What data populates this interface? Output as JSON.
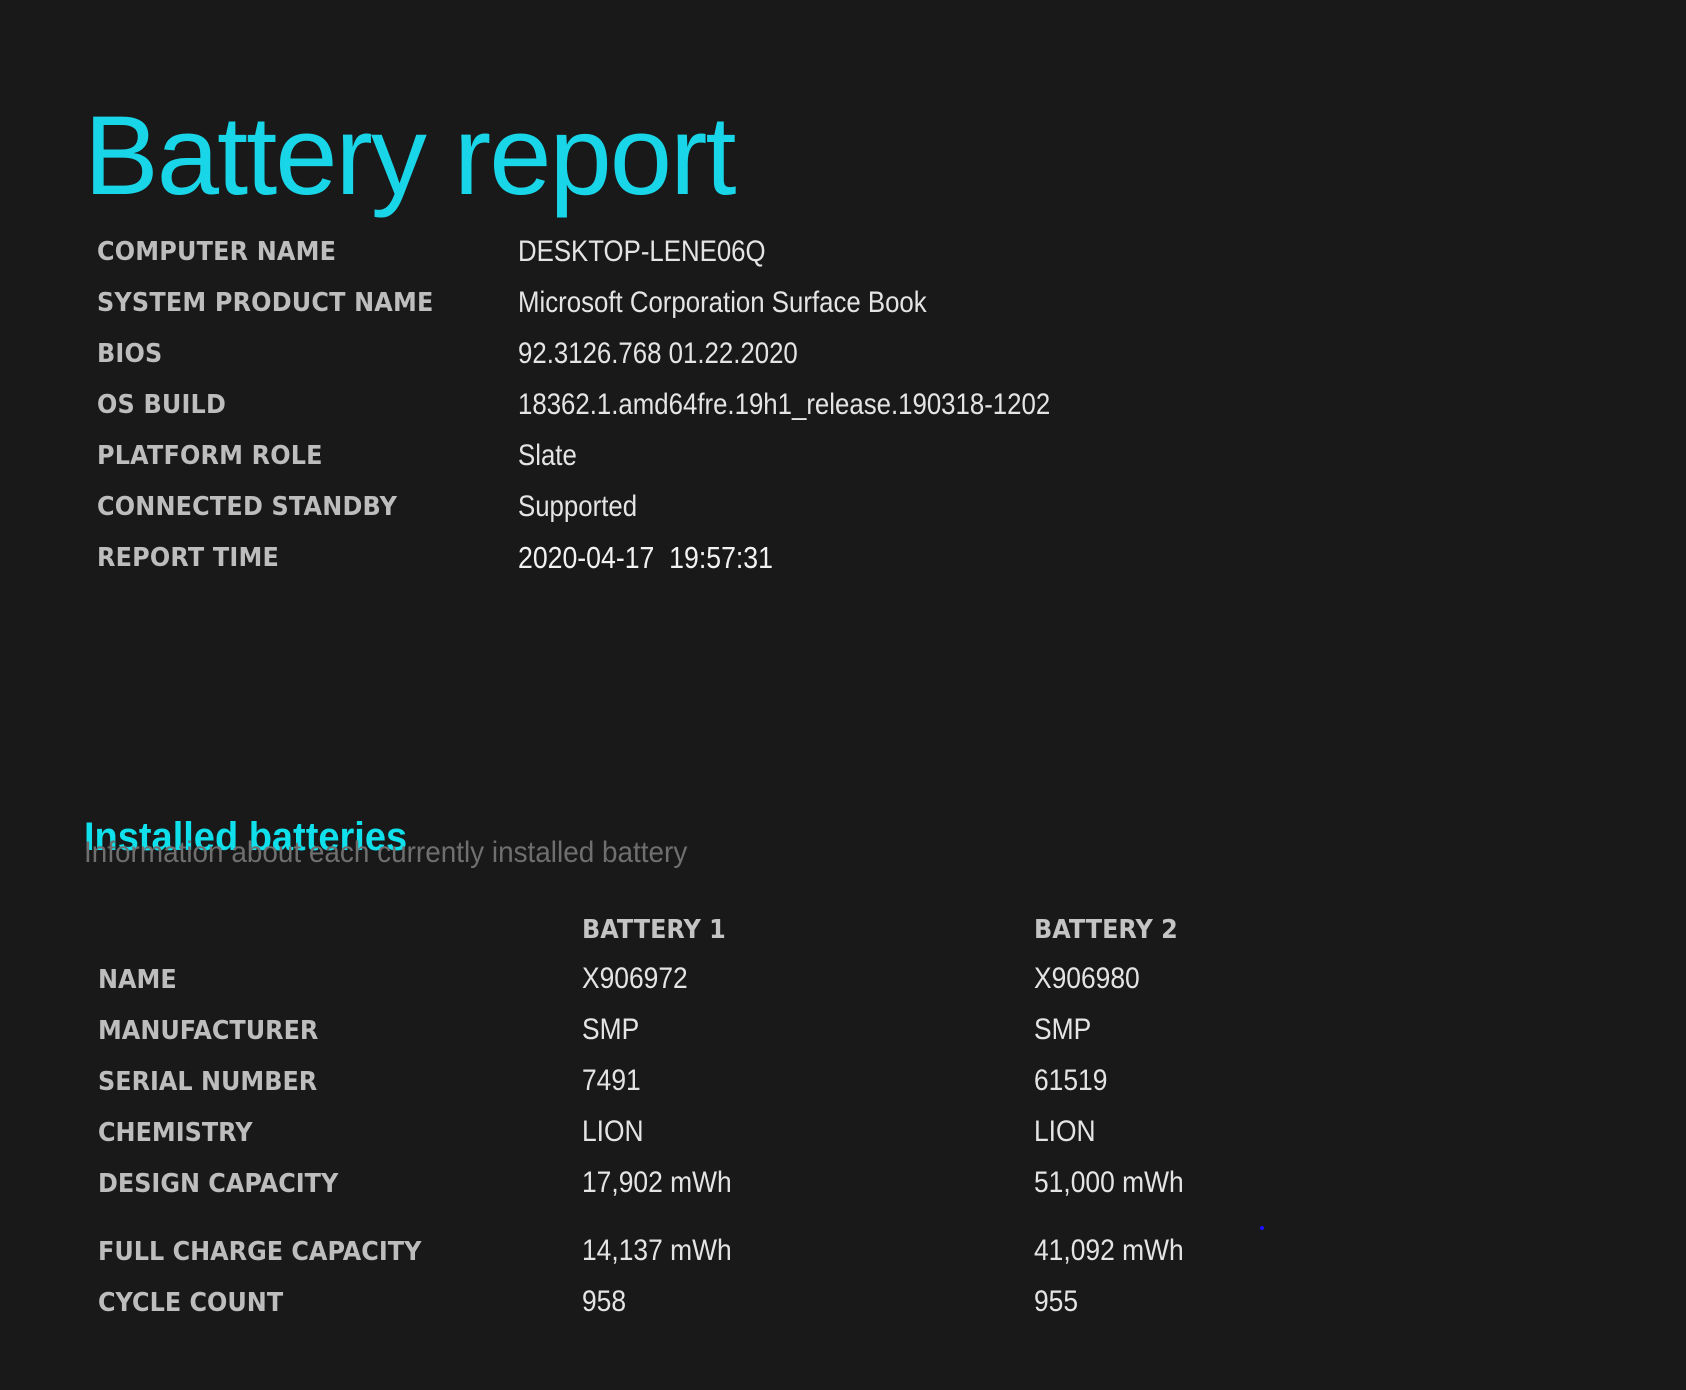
{
  "theme": {
    "accent": "#18D6E8",
    "accent_section": "#0FE0EC",
    "background": "#191919"
  },
  "header": {
    "title": "Battery report"
  },
  "system_info": [
    {
      "label": "COMPUTER NAME",
      "value": "DESKTOP-LENE06Q"
    },
    {
      "label": "SYSTEM PRODUCT NAME",
      "value": "Microsoft Corporation Surface Book"
    },
    {
      "label": "BIOS",
      "value": "92.3126.768 01.22.2020"
    },
    {
      "label": "OS BUILD",
      "value": "18362.1.amd64fre.19h1_release.190318-1202"
    },
    {
      "label": "PLATFORM ROLE",
      "value": "Slate"
    },
    {
      "label": "CONNECTED STANDBY",
      "value": "Supported"
    },
    {
      "label": "REPORT TIME",
      "value": "2020-04-17  19:57:31"
    }
  ],
  "installed_batteries": {
    "title": "Installed batteries",
    "subtitle": "Information about each currently installed battery",
    "columns": [
      "BATTERY 1",
      "BATTERY 2"
    ],
    "rows": [
      {
        "label": "NAME",
        "values": [
          "X906972",
          "X906980"
        ]
      },
      {
        "label": "MANUFACTURER",
        "values": [
          "SMP",
          "SMP"
        ]
      },
      {
        "label": "SERIAL NUMBER",
        "values": [
          "7491",
          "61519"
        ]
      },
      {
        "label": "CHEMISTRY",
        "values": [
          "LION",
          "LION"
        ]
      },
      {
        "label": "DESIGN CAPACITY",
        "values": [
          "17,902 mWh",
          "51,000 mWh"
        ]
      },
      {
        "label": "FULL CHARGE CAPACITY",
        "values": [
          "14,137 mWh",
          "41,092 mWh"
        ]
      },
      {
        "label": "CYCLE COUNT",
        "values": [
          "958",
          "955"
        ]
      }
    ]
  }
}
